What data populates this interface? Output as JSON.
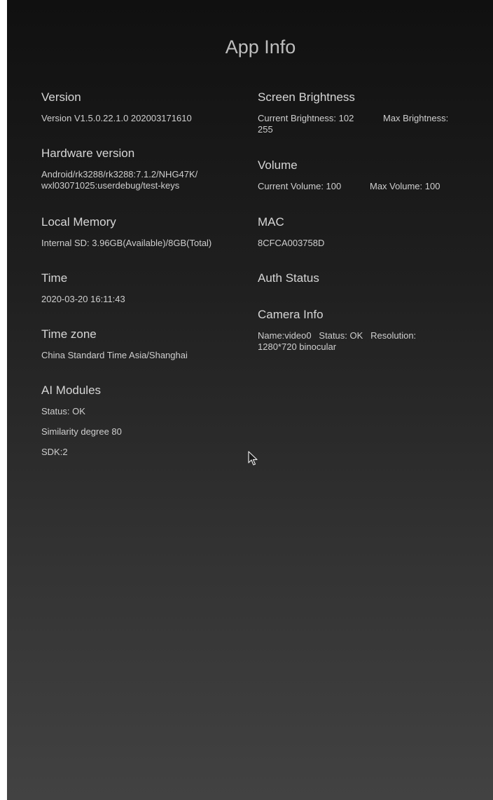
{
  "page": {
    "title": "App Info"
  },
  "left": {
    "version": {
      "heading": "Version",
      "value": "Version  V1.5.0.22.1.0  202003171610"
    },
    "hardware": {
      "heading": "Hardware version",
      "line1": "Android/rk3288/rk3288:7.1.2/NHG47K/",
      "line2": "wxl03071025:userdebug/test-keys"
    },
    "memory": {
      "heading": "Local Memory",
      "value": "Internal SD: 3.96GB(Available)/8GB(Total)"
    },
    "time": {
      "heading": "Time",
      "value": "2020-03-20 16:11:43"
    },
    "timezone": {
      "heading": "Time zone",
      "value": "China Standard Time Asia/Shanghai"
    },
    "ai": {
      "heading": "AI Modules",
      "status": "Status: OK",
      "similarity": "Similarity degree 80",
      "sdk": "SDK:2"
    }
  },
  "right": {
    "brightness": {
      "heading": "Screen Brightness",
      "current": "Current Brightness: 102",
      "max_line1": "Max Brightness:",
      "max_line2": "255"
    },
    "volume": {
      "heading": "Volume",
      "current": "Current Volume: 100",
      "max": "Max Volume: 100"
    },
    "mac": {
      "heading": "MAC",
      "value": "8CFCA003758D"
    },
    "auth": {
      "heading": "Auth Status"
    },
    "camera": {
      "heading": "Camera Info",
      "line1": "Name:video0   Status: OK   Resolution:",
      "line2": "1280*720  binocular"
    }
  },
  "icons": {
    "cursor": "mouse-pointer-icon"
  }
}
